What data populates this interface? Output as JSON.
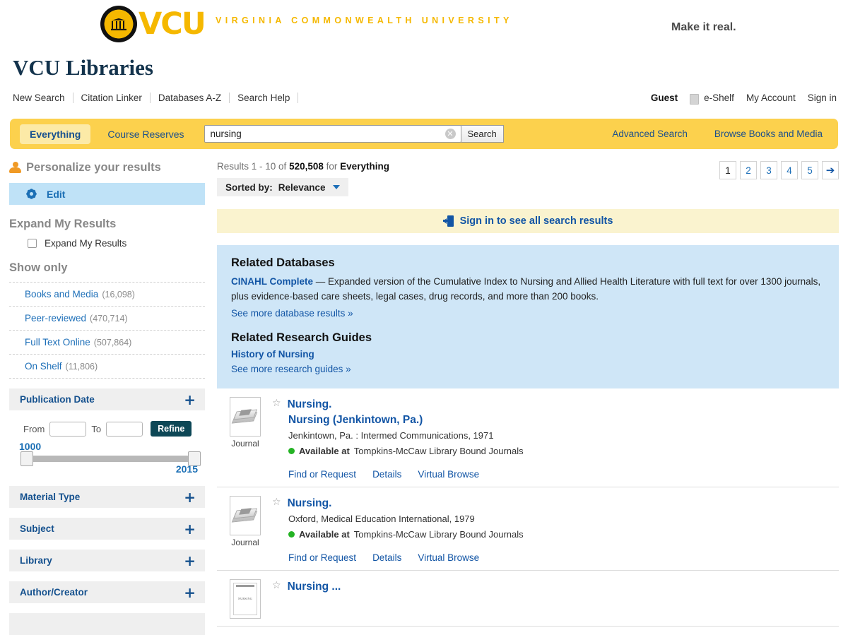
{
  "brand": {
    "logo_text": "VCU",
    "university_name": "VIRGINIA COMMONWEALTH UNIVERSITY",
    "tagline": "Make it real.",
    "site_title": "VCU Libraries",
    "seal_icon": "vcu-seal-icon"
  },
  "utility_nav": [
    {
      "label": "New Search"
    },
    {
      "label": "Citation Linker"
    },
    {
      "label": "Databases A-Z"
    },
    {
      "label": "Search Help"
    }
  ],
  "account_nav": {
    "guest_label": "Guest",
    "eshelf_label": "e-Shelf",
    "my_account_label": "My Account",
    "sign_in_label": "Sign in"
  },
  "search": {
    "scopes": [
      {
        "label": "Everything",
        "active": true
      },
      {
        "label": "Course Reserves",
        "active": false
      }
    ],
    "query": "nursing",
    "placeholder": "",
    "clear_label": "✕",
    "search_button": "Search",
    "advanced_search": "Advanced Search",
    "browse_books": "Browse Books and Media"
  },
  "sidebar": {
    "personalize_title": "Personalize your results",
    "edit_label": "Edit",
    "expand_heading": "Expand My Results",
    "expand_checkbox_label": "Expand My Results",
    "show_only_heading": "Show only",
    "show_only": [
      {
        "label": "Books and Media",
        "count": "(16,098)"
      },
      {
        "label": "Peer-reviewed",
        "count": "(470,714)"
      },
      {
        "label": "Full Text Online",
        "count": "(507,864)"
      },
      {
        "label": "On Shelf",
        "count": "(11,806)"
      }
    ],
    "publication_date": {
      "title": "Publication Date",
      "from_label": "From",
      "to_label": "To",
      "from_value": "",
      "to_value": "",
      "refine_label": "Refine",
      "slider_min": "1000",
      "slider_max": "2015"
    },
    "facets": [
      {
        "title": "Material Type"
      },
      {
        "title": "Subject"
      },
      {
        "title": "Library"
      },
      {
        "title": "Author/Creator"
      }
    ]
  },
  "results_header": {
    "prefix": "Results 1 - 10 of",
    "total": "520,508",
    "middle": "for",
    "scope": "Everything",
    "sorted_by_label": "Sorted by:",
    "sorted_by_value": "Relevance"
  },
  "pagination": {
    "pages": [
      "1",
      "2",
      "3",
      "4",
      "5"
    ],
    "current": "1",
    "next_icon": "➔"
  },
  "signin_banner": {
    "text": "Sign in to see all search results",
    "icon": "sign-in-icon"
  },
  "related": {
    "databases_heading": "Related Databases",
    "database_name": "CINAHL Complete",
    "database_desc": "— Expanded version of the Cumulative Index to Nursing and Allied Health Literature with full text for over 1300 journals, plus evidence-based care sheets, legal cases, drug records, and more than 200 books.",
    "see_more_databases": "See more database results »",
    "guides_heading": "Related Research Guides",
    "guide_name": "History of Nursing",
    "see_more_guides": "See more research guides »"
  },
  "results": [
    {
      "title": "Nursing.",
      "subtitle": "Nursing (Jenkintown, Pa.)",
      "meta": "Jenkintown, Pa. : Intermed Communications, 1971",
      "availability_strong": "Available at",
      "availability_rest": "Tompkins-McCaw Library Bound Journals",
      "type_label": "Journal",
      "thumb_kind": "journal",
      "actions": [
        "Find or Request",
        "Details",
        "Virtual Browse"
      ]
    },
    {
      "title": "Nursing.",
      "subtitle": "",
      "meta": "Oxford, Medical Education International, 1979",
      "availability_strong": "Available at",
      "availability_rest": "Tompkins-McCaw Library Bound Journals",
      "type_label": "Journal",
      "thumb_kind": "journal",
      "actions": [
        "Find or Request",
        "Details",
        "Virtual Browse"
      ]
    },
    {
      "title": "Nursing ...",
      "subtitle": "",
      "meta": "",
      "availability_strong": "",
      "availability_rest": "",
      "type_label": "",
      "thumb_kind": "book",
      "thumb_cover_text": "NURSING",
      "actions": []
    }
  ]
}
